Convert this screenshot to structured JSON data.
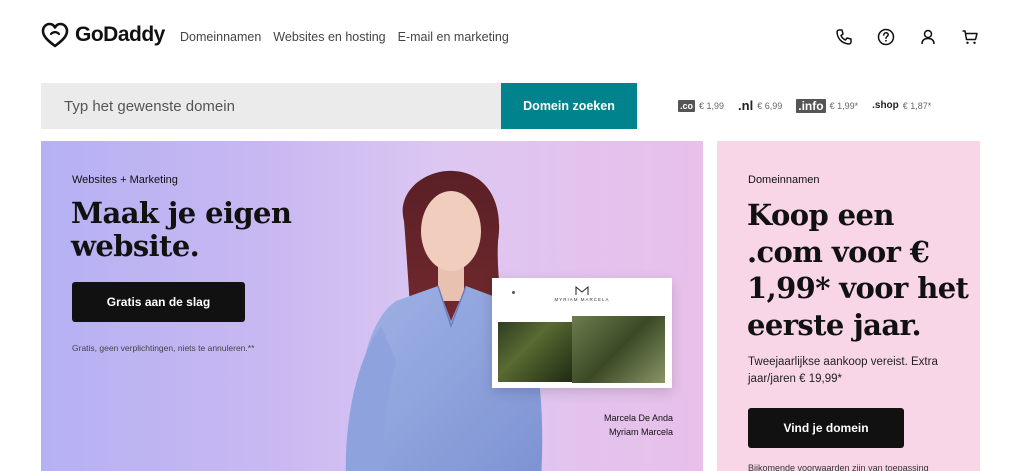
{
  "header": {
    "logo_text": "GoDaddy",
    "nav": [
      "Domeinnamen",
      "Websites en hosting",
      "E-mail en marketing"
    ],
    "icons": [
      "phone-icon",
      "help-icon",
      "account-icon",
      "cart-icon"
    ]
  },
  "search": {
    "placeholder": "Typ het gewenste domein",
    "button_label": "Domein zoeken"
  },
  "tlds": [
    {
      "badge": ".co",
      "price": "€ 1,99"
    },
    {
      "badge": ".nl",
      "price": "€ 6,99"
    },
    {
      "badge": ".info",
      "price": "€ 1,99*"
    },
    {
      "badge": ".shop",
      "price": "€ 1,87*"
    }
  ],
  "hero_left": {
    "eyebrow": "Websites + Marketing",
    "title": "Maak je eigen website.",
    "cta": "Gratis aan de slag",
    "note": "Gratis, geen verplichtingen, niets te annuleren.**",
    "mock_brand": "MYRIAM MARCELA",
    "caption_line1": "Marcela De Anda",
    "caption_line2": "Myriam Marcela"
  },
  "hero_right": {
    "eyebrow": "Domeinnamen",
    "title": "Koop een .com voor € 1,99* voor het eerste jaar.",
    "description": "Tweejaarlijkse aankoop vereist. Extra jaar/jaren € 19,99*",
    "cta": "Vind je domein",
    "footnote": "Bijkomende voorwaarden zijn van toepassing"
  },
  "colors": {
    "accent": "#00838c",
    "hero_left_bg": "#c9b8f2",
    "hero_right_bg": "#f8d6e8",
    "button_dark": "#111111"
  }
}
